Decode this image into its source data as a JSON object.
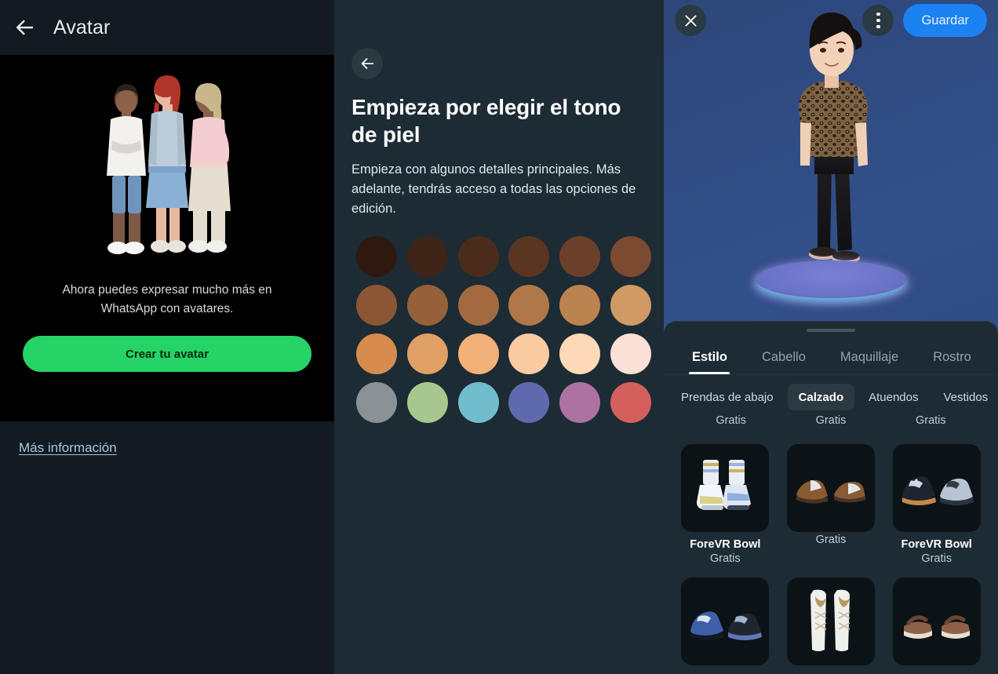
{
  "left_panel": {
    "appbar": {
      "back_icon": "arrow-left-icon",
      "title": "Avatar"
    },
    "hero": {
      "illustration": "avatar-trio-illustration",
      "caption": "Ahora puedes expresar mucho más en WhatsApp con avatares.",
      "cta_label": "Crear tu avatar",
      "cta_color": "#25d366"
    },
    "footer": {
      "more_info_label": "Más información",
      "link_color": "#a8c7e0"
    }
  },
  "middle_panel": {
    "back_icon": "arrow-left-icon",
    "title": "Empieza por elegir el tono de piel",
    "description": "Empieza con algunos detalles principales. Más adelante, tendrás acceso a todas las opciones de edición.",
    "skin_tones": [
      {
        "name": "skin-tone-1",
        "hex": "#2e1810"
      },
      {
        "name": "skin-tone-2",
        "hex": "#3e2317"
      },
      {
        "name": "skin-tone-3",
        "hex": "#4b2c1b"
      },
      {
        "name": "skin-tone-4",
        "hex": "#5a3622"
      },
      {
        "name": "skin-tone-5",
        "hex": "#6b402a"
      },
      {
        "name": "skin-tone-6",
        "hex": "#7c4a30"
      },
      {
        "name": "skin-tone-7",
        "hex": "#8a5635"
      },
      {
        "name": "skin-tone-8",
        "hex": "#96603b"
      },
      {
        "name": "skin-tone-9",
        "hex": "#a26a40"
      },
      {
        "name": "skin-tone-10",
        "hex": "#b07849"
      },
      {
        "name": "skin-tone-11",
        "hex": "#bb8350"
      },
      {
        "name": "skin-tone-12",
        "hex": "#cf9a64"
      },
      {
        "name": "skin-tone-13",
        "hex": "#d88b4e"
      },
      {
        "name": "skin-tone-14",
        "hex": "#e0a066"
      },
      {
        "name": "skin-tone-15",
        "hex": "#f2b178"
      },
      {
        "name": "skin-tone-16",
        "hex": "#fbcba2"
      },
      {
        "name": "skin-tone-17",
        "hex": "#fdd9b8"
      },
      {
        "name": "skin-tone-18",
        "hex": "#fae0d6"
      },
      {
        "name": "skin-tone-19",
        "hex": "#8b9296"
      },
      {
        "name": "skin-tone-20",
        "hex": "#a8c78e"
      },
      {
        "name": "skin-tone-21",
        "hex": "#71bccd"
      },
      {
        "name": "skin-tone-22",
        "hex": "#5f6aae"
      },
      {
        "name": "skin-tone-23",
        "hex": "#ad71a2"
      },
      {
        "name": "skin-tone-24",
        "hex": "#d4605e"
      }
    ]
  },
  "right_panel": {
    "topbar": {
      "close_icon": "close-icon",
      "menu_icon": "more-vertical-icon",
      "save_label": "Guardar",
      "save_color": "#1b82f2"
    },
    "preview": {
      "avatar": "avatar-3d-preview",
      "platform": "glowing-disc-platform"
    },
    "sheet": {
      "handle": "drag-handle",
      "tabs": [
        {
          "label": "Estilo",
          "active": true
        },
        {
          "label": "Cabello",
          "active": false
        },
        {
          "label": "Maquillaje",
          "active": false
        },
        {
          "label": "Rostro",
          "active": false
        }
      ],
      "chips": [
        {
          "label": "Prendas de abajo",
          "active": false
        },
        {
          "label": "Calzado",
          "active": true
        },
        {
          "label": "Atuendos",
          "active": false
        },
        {
          "label": "Vestidos",
          "active": false
        }
      ],
      "partial_row_prices": [
        "Gratis",
        "Gratis",
        "Gratis"
      ],
      "items": [
        {
          "thumb": "sneaker-socks-thumb",
          "name": "ForeVR Bowl",
          "price": "Gratis"
        },
        {
          "thumb": "brown-dress-shoes-thumb",
          "name": "",
          "price": "Gratis"
        },
        {
          "thumb": "blue-sneakers-thumb",
          "name": "ForeVR Bowl",
          "price": "Gratis"
        },
        {
          "thumb": "navy-sneakers-thumb",
          "name": "",
          "price": ""
        },
        {
          "thumb": "white-knee-socks-thumb",
          "name": "",
          "price": ""
        },
        {
          "thumb": "brown-sandals-thumb",
          "name": "",
          "price": ""
        }
      ]
    }
  }
}
